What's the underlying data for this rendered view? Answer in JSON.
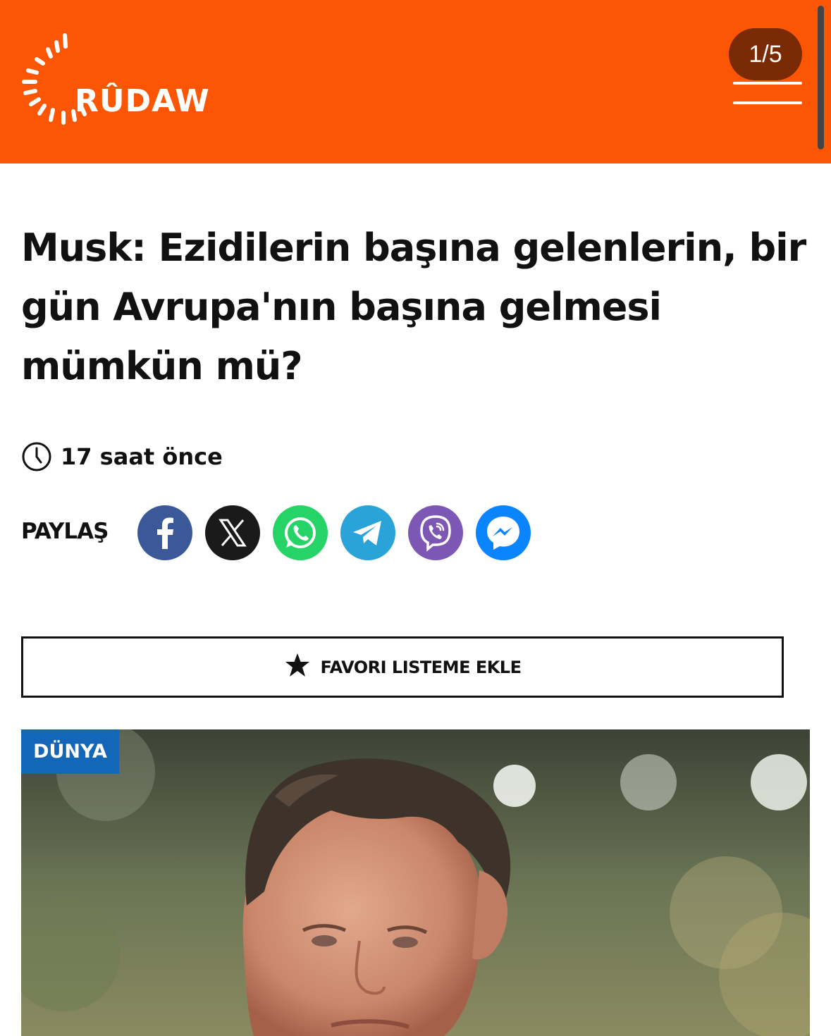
{
  "header": {
    "logo_text": "RÛDAW",
    "page_counter": "1/5",
    "brand_color": "#fc5604"
  },
  "article": {
    "title": "Musk: Ezidilerin başına gelenlerin, bir gün Avrupa'nın başına gelmesi mümkün mü?",
    "time": "17 saat önce",
    "share_label": "PAYLAŞ",
    "share_buttons": [
      {
        "icon": "facebook-icon",
        "color": "#3b5998"
      },
      {
        "icon": "x-icon",
        "color": "#1a1a1a"
      },
      {
        "icon": "whatsapp-icon",
        "color": "#25d366"
      },
      {
        "icon": "telegram-icon",
        "color": "#2aa3d8"
      },
      {
        "icon": "viber-icon",
        "color": "#7d57b4"
      },
      {
        "icon": "messenger-icon",
        "color": "#0b84ff"
      }
    ],
    "favorite_label": "FAVORI LISTEME EKLE",
    "category": "DÜNYA",
    "category_color": "#1366b8"
  }
}
